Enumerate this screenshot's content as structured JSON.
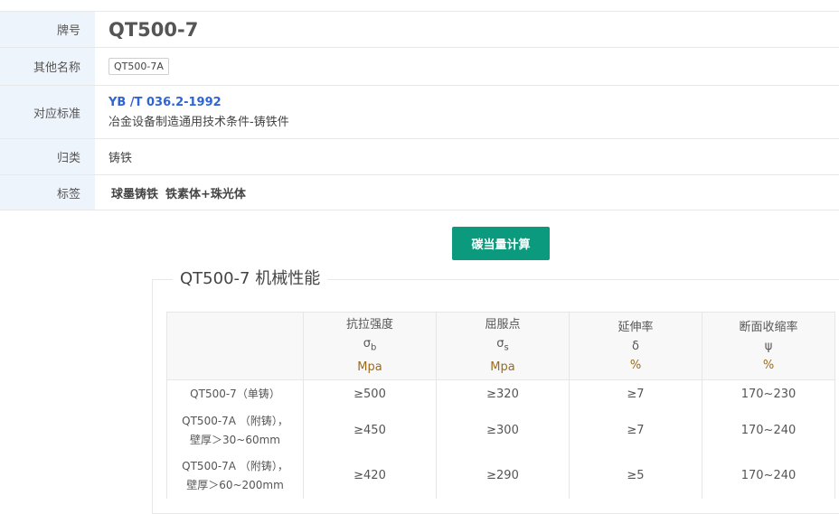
{
  "info": {
    "grade_label": "牌号",
    "grade": "QT500-7",
    "other_names_label": "其他名称",
    "other_names": [
      "QT500-7A"
    ],
    "standard_label": "对应标准",
    "standard_code": "YB /T 036.2-1992",
    "standard_name": "冶金设备制造通用技术条件-铸铁件",
    "category_label": "归类",
    "category": "铸铁",
    "tags_label": "标签",
    "tags": [
      "球墨铸铁",
      "铁素体+珠光体"
    ]
  },
  "calc_button": "碳当量计算",
  "mech": {
    "title": "QT500-7 机械性能",
    "headers": [
      {
        "name": "抗拉强度",
        "symbol": "σ",
        "sub": "b",
        "unit": "Mpa"
      },
      {
        "name": "屈服点",
        "symbol": "σ",
        "sub": "s",
        "unit": "Mpa"
      },
      {
        "name": "延伸率",
        "symbol": "δ",
        "sub": "",
        "unit": "%"
      },
      {
        "name": "断面收缩率",
        "symbol": "ψ",
        "sub": "",
        "unit": "%"
      }
    ],
    "rows": [
      {
        "grade": "QT500-7（单铸）",
        "grade2": "",
        "values": [
          "≥500",
          "≥320",
          "≥7",
          "170~230"
        ]
      },
      {
        "grade": "QT500-7A （附铸），",
        "grade2": "壁厚＞30~60mm",
        "values": [
          "≥450",
          "≥300",
          "≥7",
          "170~240"
        ]
      },
      {
        "grade": "QT500-7A （附铸），",
        "grade2": "壁厚＞60~200mm",
        "values": [
          "≥420",
          "≥290",
          "≥5",
          "170~240"
        ]
      }
    ]
  }
}
